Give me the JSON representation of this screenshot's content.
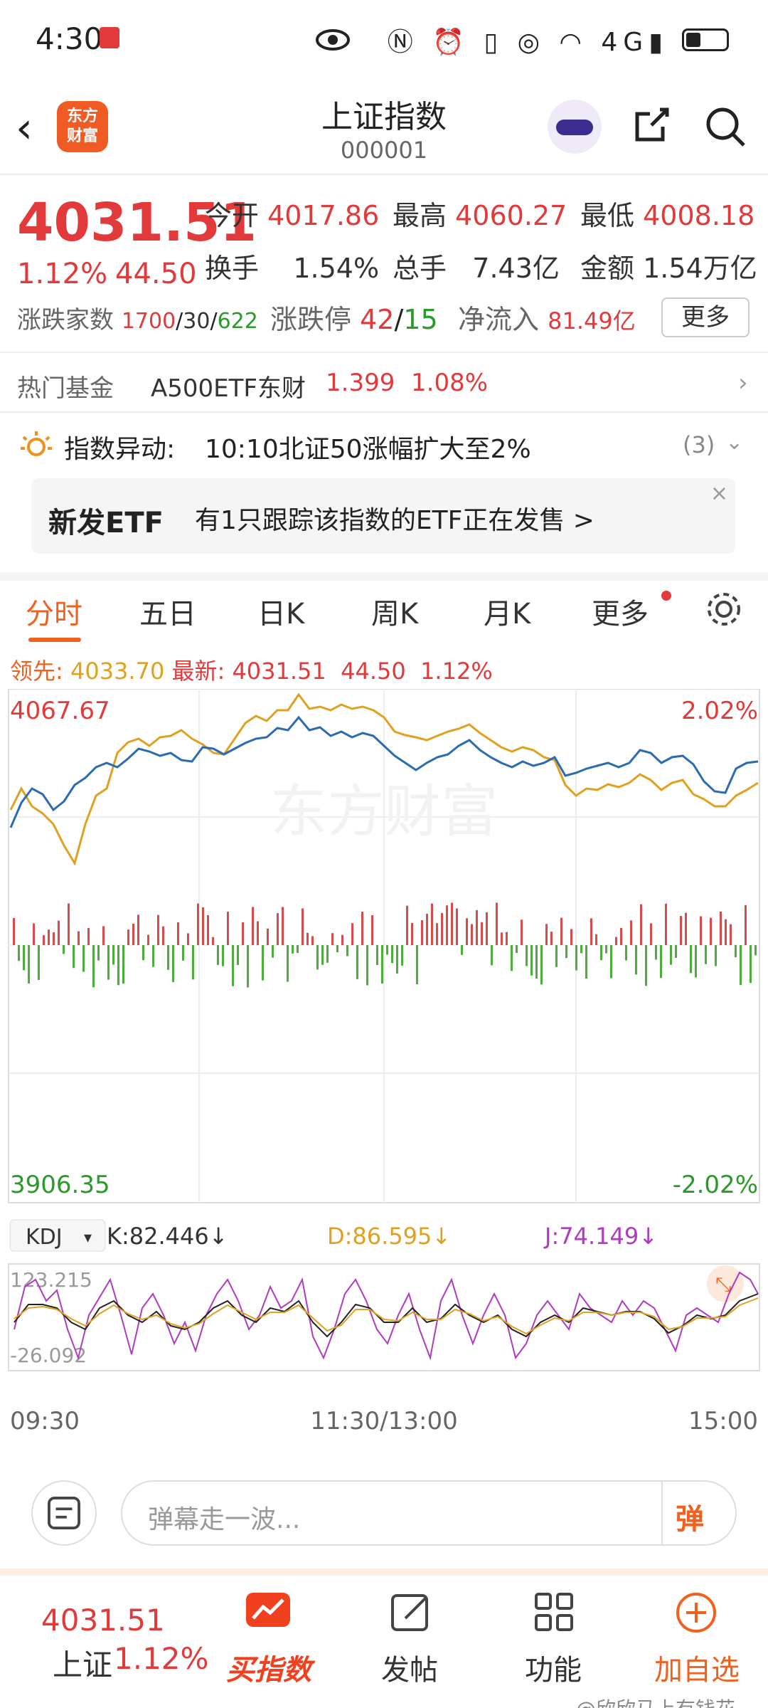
{
  "status": {
    "time": "4:30",
    "net": "4G"
  },
  "header": {
    "logo": "东方\n财富",
    "title": "上证指数",
    "code": "000001"
  },
  "quote": {
    "price": "4031.51",
    "change_pct": "1.12%",
    "change_amt": "44.50",
    "open_label": "今开",
    "open": "4017.86",
    "high_label": "最高",
    "high": "4060.27",
    "low_label": "最低",
    "low": "4008.18",
    "turnover_label": "换手",
    "turnover": "1.54%",
    "volume_label": "总手",
    "volume": "7.43亿",
    "amount_label": "金额",
    "amount": "1.54万亿",
    "advdec_label": "涨跌家数",
    "adv": "1700",
    "flat": "30",
    "dec": "622",
    "limit_label": "涨跌停",
    "limit_up": "42",
    "limit_down": "15",
    "inflow_label": "净流入",
    "inflow": "81.49亿",
    "more": "更多"
  },
  "hot_fund": {
    "label": "热门基金",
    "name": "A500ETF东财",
    "price": "1.399",
    "pct": "1.08%"
  },
  "alert": {
    "label": "指数异动:",
    "text": "10:10北证50涨幅扩大至2%",
    "count": "(3)"
  },
  "etf": {
    "label": "新发ETF",
    "text": "有1只跟踪该指数的ETF正在发售 >",
    "close": "×"
  },
  "tabs": [
    "分时",
    "五日",
    "日K",
    "周K",
    "月K",
    "更多"
  ],
  "lead_line": {
    "lead_label": "领先:",
    "lead": "4033.70",
    "latest_label": "最新:",
    "latest": "4031.51",
    "chg": "44.50",
    "pct": "1.12%"
  },
  "chart_data": {
    "type": "line",
    "y_top": "4067.67",
    "y_bottom": "3906.35",
    "pct_top": "2.02%",
    "pct_bottom": "-2.02%",
    "x_labels": [
      "09:30",
      "11:30/13:00",
      "15:00"
    ],
    "watermark": "东方财富",
    "kdj": {
      "label": "KDJ",
      "k": "K:82.446↓",
      "d": "D:86.595↓",
      "j": "J:74.149↓",
      "max": "123.215",
      "min": "-26.092"
    }
  },
  "input": {
    "placeholder": "弹幕走一波...",
    "button": "弹"
  },
  "bottom": {
    "price": "4031.51",
    "name": "上证",
    "pct": "1.12%",
    "buy": "买指数",
    "post": "发帖",
    "func": "功能",
    "add": "加自选",
    "watermark": "@欣欣马上有钱花"
  }
}
